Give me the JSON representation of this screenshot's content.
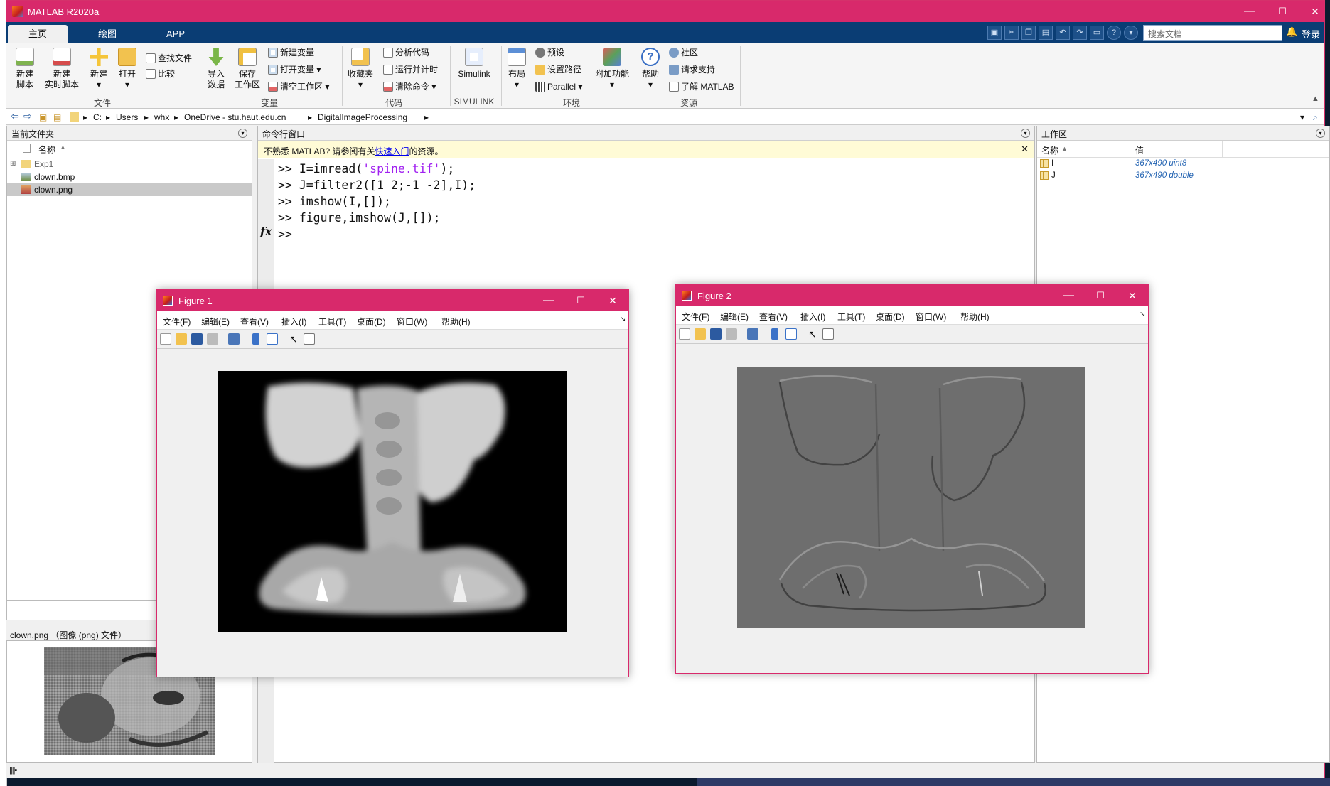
{
  "window": {
    "title": "MATLAB R2020a",
    "min": "—",
    "max": "☐",
    "close": "✕"
  },
  "tabs": [
    "主页",
    "绘图",
    "APP"
  ],
  "search": {
    "placeholder": "搜索文档"
  },
  "login": "登录",
  "ribbon": {
    "new_script": [
      "新建",
      "脚本"
    ],
    "new_live": [
      "新建",
      "实时脚本"
    ],
    "new": "新建",
    "open": "打开",
    "find_files": "查找文件",
    "compare": "比较",
    "import": [
      "导入",
      "数据"
    ],
    "save_ws": [
      "保存",
      "工作区"
    ],
    "new_var": "新建变量",
    "open_var": "打开变量",
    "clear_ws": "清空工作区",
    "favorites": "收藏夹",
    "analyze": "分析代码",
    "run_time": "运行并计时",
    "clear_cmd": "清除命令",
    "simulink": "Simulink",
    "layout": "布局",
    "prefs": "预设",
    "set_path": "设置路径",
    "parallel": "Parallel",
    "addons": "附加功能",
    "help": "帮助",
    "community": "社区",
    "support": "请求支持",
    "learn": "了解 MATLAB",
    "groups": {
      "file": "文件",
      "variable": "变量",
      "code": "代码",
      "simulink": "SIMULINK",
      "env": "环境",
      "resources": "资源"
    }
  },
  "path": [
    "C:",
    "Users",
    "whx",
    "OneDrive - stu.haut.edu.cn",
    "DigitalImageProcessing"
  ],
  "current_folder": {
    "title": "当前文件夹",
    "col": "名称",
    "items": [
      {
        "name": "Exp1",
        "type": "folder"
      },
      {
        "name": "clown.bmp",
        "type": "image"
      },
      {
        "name": "clown.png",
        "type": "image",
        "selected": true
      }
    ],
    "details_title": "clown.png （图像 (png) 文件）"
  },
  "command": {
    "title": "命令行窗口",
    "notice_pre": "不熟悉 MATLAB? 请参阅有关",
    "notice_link": "快速入门",
    "notice_post": "的资源。",
    "lines": [
      {
        "p": ">> ",
        "a": "I=imread(",
        "s": "'spine.tif'",
        "b": ");"
      },
      {
        "p": ">> ",
        "a": "J=filter2([1 2;-1 -2],I);",
        "s": "",
        "b": ""
      },
      {
        "p": ">> ",
        "a": "imshow(I,[]);",
        "s": "",
        "b": ""
      },
      {
        "p": ">> ",
        "a": "figure,imshow(J,[]);",
        "s": "",
        "b": ""
      },
      {
        "p": ">> ",
        "a": "",
        "s": "",
        "b": ""
      }
    ],
    "fx": "fx"
  },
  "workspace": {
    "title": "工作区",
    "col_name": "名称",
    "col_value": "值",
    "vars": [
      {
        "name": "I",
        "value": "367x490 uint8"
      },
      {
        "name": "J",
        "value": "367x490 double"
      }
    ]
  },
  "figures": [
    {
      "title": "Figure 1",
      "menus": [
        "文件(F)",
        "编辑(E)",
        "查看(V)",
        "插入(I)",
        "工具(T)",
        "桌面(D)",
        "窗口(W)",
        "帮助(H)"
      ]
    },
    {
      "title": "Figure 2",
      "menus": [
        "文件(F)",
        "编辑(E)",
        "查看(V)",
        "插入(I)",
        "工具(T)",
        "桌面(D)",
        "窗口(W)",
        "帮助(H)"
      ]
    }
  ],
  "colors": {
    "titlebar": "#d8296b",
    "tabbar": "#0a3d74",
    "string": "#a020f0",
    "link": "#0000ee"
  }
}
